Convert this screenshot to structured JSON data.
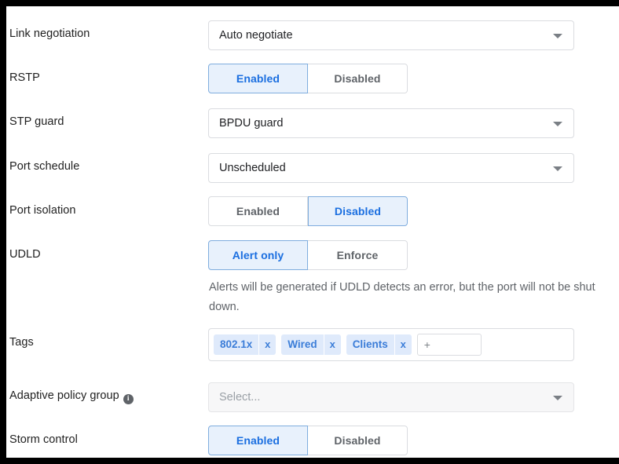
{
  "form": {
    "rows": [
      {
        "label": "Link negotiation",
        "control": "select",
        "value": "Auto negotiate",
        "name": "link-negotiation"
      },
      {
        "label": "RSTP",
        "control": "toggle",
        "options": [
          "Enabled",
          "Disabled"
        ],
        "selected": "Enabled",
        "name": "rstp"
      },
      {
        "label": "STP guard",
        "control": "select",
        "value": "BPDU guard",
        "name": "stp-guard"
      },
      {
        "label": "Port schedule",
        "control": "select",
        "value": "Unscheduled",
        "name": "port-schedule"
      },
      {
        "label": "Port isolation",
        "control": "toggle",
        "options": [
          "Enabled",
          "Disabled"
        ],
        "selected": "Disabled",
        "name": "port-isolation"
      },
      {
        "label": "UDLD",
        "control": "toggle",
        "options": [
          "Alert only",
          "Enforce"
        ],
        "selected": "Alert only",
        "name": "udld",
        "help": "Alerts will be generated if UDLD detects an error, but the port will not be shut down."
      },
      {
        "label": "Tags",
        "control": "tags",
        "tags": [
          "802.1x",
          "Wired",
          "Clients"
        ],
        "remove_label": "x",
        "add_label": "+",
        "name": "tags"
      },
      {
        "label": "Adaptive policy group",
        "control": "select",
        "value": "Select...",
        "disabled": true,
        "info": "i",
        "name": "adaptive-policy-group"
      },
      {
        "label": "Storm control",
        "control": "toggle",
        "options": [
          "Enabled",
          "Disabled"
        ],
        "selected": "Enabled",
        "name": "storm-control"
      }
    ]
  },
  "labels": {
    "link_negotiation": "Link negotiation",
    "rstp": "RSTP",
    "stp_guard": "STP guard",
    "port_schedule": "Port schedule",
    "port_isolation": "Port isolation",
    "udld": "UDLD",
    "tags": "Tags",
    "adaptive_policy_group": "Adaptive policy group",
    "storm_control": "Storm control"
  },
  "values": {
    "link_negotiation": "Auto negotiate",
    "stp_guard": "BPDU guard",
    "port_schedule": "Unscheduled",
    "adaptive_policy_group_placeholder": "Select..."
  },
  "toggles": {
    "enabled": "Enabled",
    "disabled": "Disabled",
    "alert_only": "Alert only",
    "enforce": "Enforce"
  },
  "udld_help": "Alerts will be generated if UDLD detects an error, but the port will not be shut down.",
  "tags": {
    "items": [
      "802.1x",
      "Wired",
      "Clients"
    ],
    "remove": "x",
    "add": "+"
  },
  "icons": {
    "info": "i"
  },
  "colors": {
    "accent_blue": "#1b6fe0",
    "chip_bg": "#dfeafb",
    "chip_text": "#3b7dd8",
    "active_bg": "#e8f1fc",
    "active_border": "#7fadde",
    "border": "#dadce0",
    "text": "#1f1f1f",
    "muted_text": "#5f6368"
  }
}
